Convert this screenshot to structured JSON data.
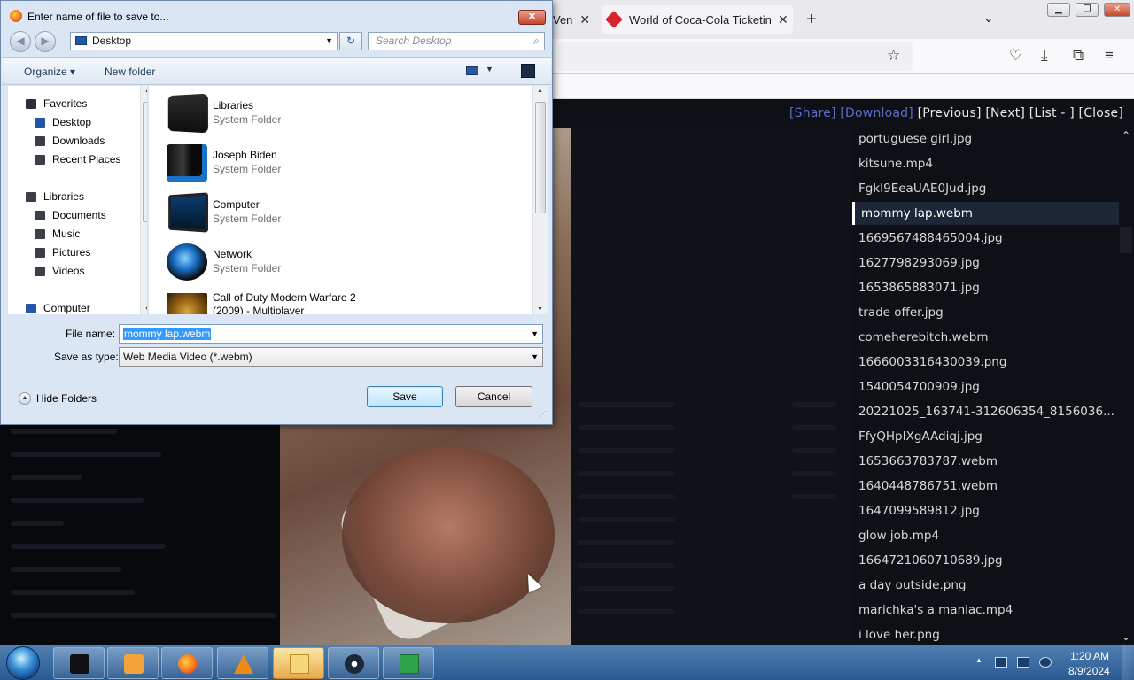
{
  "browser": {
    "tabs": [
      {
        "label": "Ven",
        "close": "✕"
      },
      {
        "label": "World of Coca-Cola Ticketing S",
        "close": "✕"
      }
    ],
    "new_tab": "+",
    "tab_list": "⌄",
    "window_buttons": {
      "minimize": "▁",
      "maximize": "❐",
      "close": "✕"
    }
  },
  "viewer": {
    "nav": {
      "share": "[Share]",
      "download": "[Download]",
      "previous": "[Previous]",
      "next": "[Next]",
      "list": "[List - ]",
      "close": "[Close]"
    },
    "files": [
      "portuguese girl.jpg",
      "kitsune.mp4",
      "FgkI9EeaUAE0Jud.jpg",
      "mommy lap.webm",
      "1669567488465004.jpg",
      "1627798293069.jpg",
      "1653865883071.jpg",
      "trade offer.jpg",
      "comeherebitch.webm",
      "1666003316430039.png",
      "1540054700909.jpg",
      "20221025_163741-312606354_8156036...",
      "FfyQHpIXgAAdiqj.jpg",
      "1653663783787.webm",
      "1640448786751.webm",
      "1647099589812.jpg",
      "glow job.mp4",
      "1664721060710689.jpg",
      "a day outside.png",
      "marichka's a maniac.mp4",
      "i love her.png"
    ],
    "selected_index": 3
  },
  "dialog": {
    "title": "Enter name of file to save to...",
    "close": "✕",
    "back": "◀",
    "forward": "▶",
    "location": "Desktop",
    "refresh": "↻",
    "search_placeholder": "Search Desktop",
    "search_icon": "⌕",
    "organize": "Organize ▾",
    "new_folder": "New folder",
    "nav_items": [
      {
        "label": "Favorites",
        "icon": "star-icon"
      },
      {
        "label": "Desktop",
        "icon": "desktop-icon"
      },
      {
        "label": "Downloads",
        "icon": "downloads-icon"
      },
      {
        "label": "Recent Places",
        "icon": "recent-places-icon"
      },
      {
        "label": "Libraries",
        "icon": "libraries-icon"
      },
      {
        "label": "Documents",
        "icon": "documents-icon"
      },
      {
        "label": "Music",
        "icon": "music-icon"
      },
      {
        "label": "Pictures",
        "icon": "pictures-icon"
      },
      {
        "label": "Videos",
        "icon": "videos-icon"
      },
      {
        "label": "Computer",
        "icon": "computer-icon"
      }
    ],
    "file_items": [
      {
        "name": "Libraries",
        "type": "System Folder",
        "icon": "libraries-folder-icon"
      },
      {
        "name": "Joseph Biden",
        "type": "System Folder",
        "icon": "user-folder-icon"
      },
      {
        "name": "Computer",
        "type": "System Folder",
        "icon": "computer-folder-icon"
      },
      {
        "name": "Network",
        "type": "System Folder",
        "icon": "network-folder-icon"
      },
      {
        "name": "Call of Duty Modern Warfare 2",
        "type": "(2009) - Multiplayer",
        "icon": "game-shortcut-icon"
      }
    ],
    "file_name_label": "File name:",
    "file_name_value": "mommy lap.webm",
    "save_type_label": "Save as type:",
    "save_type_value": "Web Media Video (*.webm)",
    "hide_folders": "Hide Folders",
    "save": "Save",
    "cancel": "Cancel"
  },
  "taskbar": {
    "time": "1:20 AM",
    "date": "8/9/2024",
    "tray_expand": "▲",
    "apps": [
      "black-folder-icon",
      "media-player-icon",
      "firefox-icon",
      "vlc-icon",
      "file-explorer-icon",
      "steam-icon",
      "install-icon"
    ]
  }
}
